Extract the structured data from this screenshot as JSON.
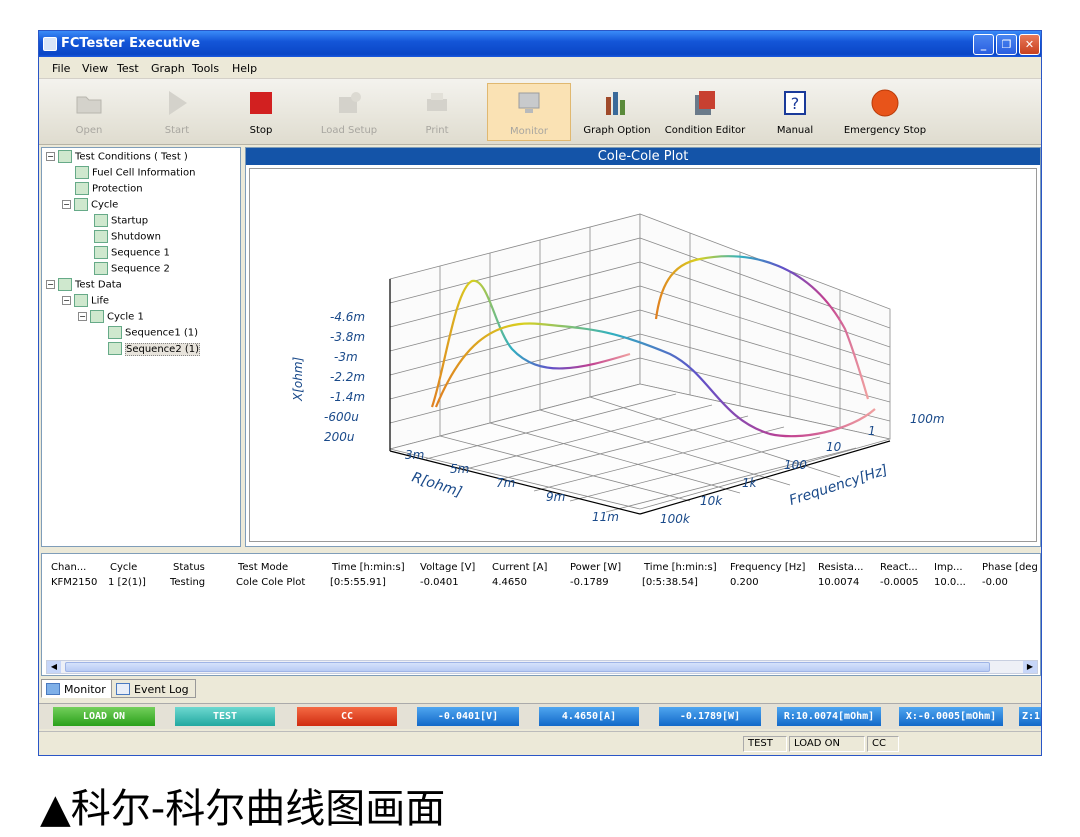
{
  "window": {
    "title": "FCTester Executive",
    "minimize": "_",
    "restore": "❐",
    "close": "✕"
  },
  "menu": [
    "File",
    "View",
    "Test",
    "Graph",
    "Tools",
    "Help"
  ],
  "toolbar": [
    {
      "label": "Open",
      "icon": "folder-icon",
      "enabled": false
    },
    {
      "label": "Start",
      "icon": "play-icon",
      "enabled": false
    },
    {
      "label": "Stop",
      "icon": "stop-icon",
      "enabled": true
    },
    {
      "label": "Load Setup",
      "icon": "load-icon",
      "enabled": false
    },
    {
      "label": "Print",
      "icon": "printer-icon",
      "enabled": false
    },
    {
      "label": "Monitor",
      "icon": "monitor-icon",
      "enabled": false,
      "active": true
    },
    {
      "label": "Graph Option",
      "icon": "graph-option-icon",
      "enabled": true
    },
    {
      "label": "Condition Editor",
      "icon": "condition-editor-icon",
      "enabled": true
    },
    {
      "label": "Manual",
      "icon": "help-icon",
      "enabled": true
    },
    {
      "label": "Emergency Stop",
      "icon": "emergency-stop-icon",
      "enabled": true
    }
  ],
  "tree": [
    {
      "label": "Test Conditions ( Test )",
      "level": 0,
      "expander": "−"
    },
    {
      "label": "Fuel Cell Information",
      "level": 1
    },
    {
      "label": "Protection",
      "level": 1
    },
    {
      "label": "Cycle",
      "level": 1,
      "expander": "−"
    },
    {
      "label": "Startup",
      "level": 2
    },
    {
      "label": "Shutdown",
      "level": 2
    },
    {
      "label": "Sequence 1",
      "level": 2
    },
    {
      "label": "Sequence 2",
      "level": 2
    },
    {
      "label": "Test Data",
      "level": 0,
      "expander": "−"
    },
    {
      "label": "Life",
      "level": 1,
      "expander": "−"
    },
    {
      "label": "Cycle 1",
      "level": 2,
      "expander": "−"
    },
    {
      "label": "Sequence1 (1)",
      "level": 3
    },
    {
      "label": "Sequence2 (1)",
      "level": 3,
      "selected": true
    }
  ],
  "plot": {
    "title": "Cole-Cole Plot",
    "z_label": "X[ohm]",
    "x_label": "R[ohm]",
    "y_label": "Frequency[Hz]",
    "z_ticks": [
      "-4.6m",
      "-3.8m",
      "-3m",
      "-2.2m",
      "-1.4m",
      "-600u",
      "200u"
    ],
    "x_ticks": [
      "3m",
      "5m",
      "7m",
      "9m",
      "11m"
    ],
    "y_ticks": [
      "100k",
      "10k",
      "1k",
      "100",
      "10",
      "1",
      "100m"
    ]
  },
  "table": {
    "headers": [
      "Chan...",
      "Cycle",
      "Status",
      "Test Mode",
      "Time [h:min:s]",
      "Voltage [V]",
      "Current [A]",
      "Power [W]",
      "Time [h:min:s]",
      "Frequency [Hz]",
      "Resista...",
      "React...",
      "Imp...",
      "Phase [deg"
    ],
    "rows": [
      [
        "KFM2150",
        "1 [2(1)]",
        "Testing",
        "Cole Cole Plot",
        "[0:5:55.91]",
        "-0.0401",
        "4.4650",
        "-0.1789",
        "[0:5:38.54]",
        "0.200",
        "10.0074",
        "-0.0005",
        "10.0...",
        "-0.00"
      ]
    ]
  },
  "tabs": [
    "Monitor",
    "Event Log"
  ],
  "status_buttons": [
    "LOAD ON",
    "TEST",
    "CC",
    "-0.0401[V]",
    "4.4650[A]",
    "-0.1789[W]",
    "R:10.0074[mOhm]",
    "X:-0.0005[mOhm]",
    "Z:1"
  ],
  "status_cells": [
    "TEST",
    "LOAD ON",
    "CC"
  ],
  "caption": "▲科尔-科尔曲线图画面"
}
